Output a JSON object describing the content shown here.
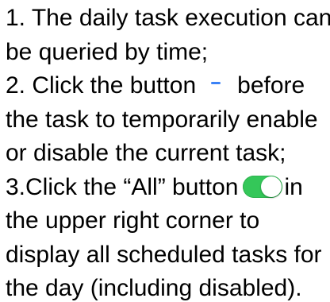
{
  "instructions": {
    "partial_top": "",
    "item1_line1": "1. The daily task execution can",
    "item1_line2": "be queried by time;",
    "item2_line1_pre": "2. Click the button",
    "item2_line1_post": "before",
    "item2_line2": "the task to temporarily enable",
    "item2_line3": "or disable the current task;",
    "item3_line1_pre": "3.Click the “All” button",
    "item3_line1_post": "in",
    "item3_line2": "the upper right corner to",
    "item3_line3": "display all scheduled tasks for",
    "item3_line4": "the day (including disabled)."
  },
  "icons": {
    "minus": "minus-icon",
    "toggle": "toggle-switch-icon"
  },
  "colors": {
    "minus_icon": "#3b82f6",
    "toggle_on": "#34c759",
    "text": "#000000"
  }
}
